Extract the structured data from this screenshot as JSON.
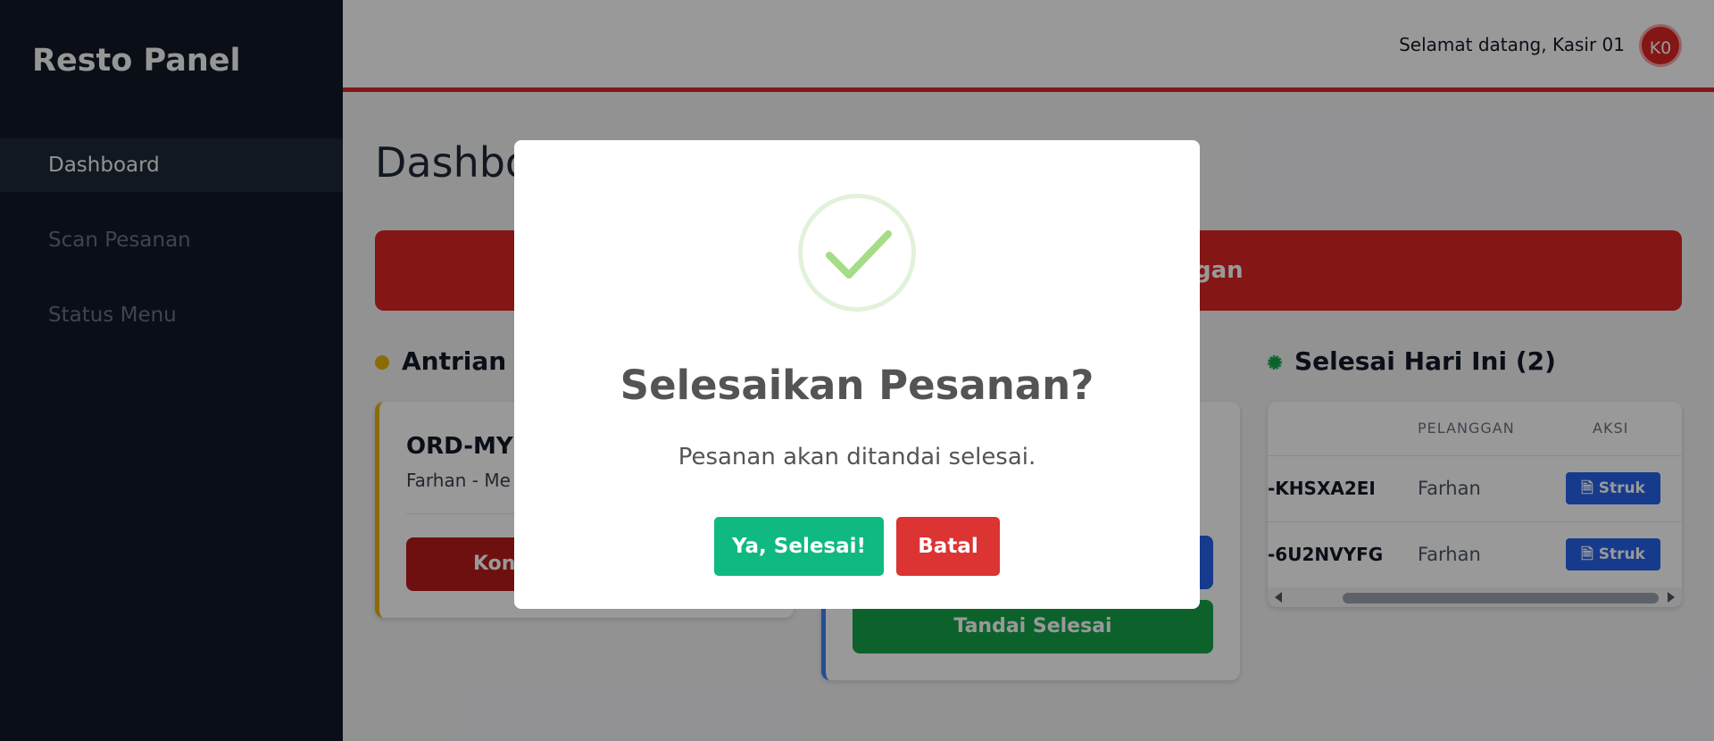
{
  "sidebar": {
    "brand": "Resto Panel",
    "items": [
      {
        "label": "Dashboard"
      },
      {
        "label": "Scan Pesanan"
      },
      {
        "label": "Status Menu"
      }
    ]
  },
  "header": {
    "welcome": "Selamat datang, Kasir 01",
    "avatar_initials": "K0"
  },
  "main": {
    "title_visible": "Dashbo",
    "banner_visible": "gan",
    "queue_title_visible": "Antrian B",
    "queue_card": {
      "order_id_visible": "ORD-MY",
      "order_sub_visible": "Farhan - Me",
      "button_visible": "Kon"
    },
    "process_card": {
      "complete_button": "Tandai Selesai"
    },
    "done_title": "Selesai Hari Ini (2)",
    "done_table": {
      "headers": [
        "PELANGGAN",
        "AKSI"
      ],
      "rows": [
        {
          "order_id": "-KHSXA2EI",
          "customer": "Farhan",
          "action": "Struk"
        },
        {
          "order_id": "-6U2NVYFG",
          "customer": "Farhan",
          "action": "Struk"
        }
      ]
    }
  },
  "modal": {
    "title": "Selesaikan Pesanan?",
    "text": "Pesanan akan ditandai selesai.",
    "confirm_label": "Ya, Selesai!",
    "cancel_label": "Batal"
  },
  "colors": {
    "accent_red": "#dc2626",
    "success_green": "#10b981",
    "queue_yellow": "#eab308",
    "process_blue": "#3b82f6"
  },
  "icons": {
    "success": "check-icon",
    "receipt": "document-icon"
  }
}
